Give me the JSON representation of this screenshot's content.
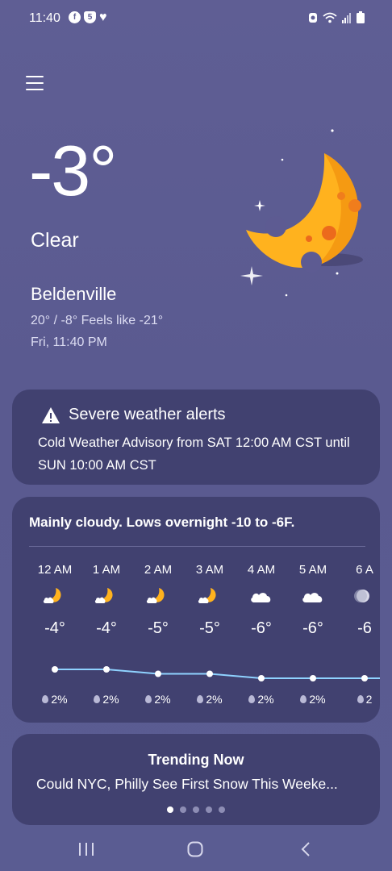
{
  "status_bar": {
    "time": "11:40",
    "left_icons": [
      "facebook-icon",
      "shield-icon",
      "heart-icon"
    ],
    "right_icons": [
      "alarm-icon",
      "wifi-icon",
      "signal-icon",
      "battery-icon"
    ]
  },
  "weather": {
    "temperature": "-3°",
    "condition": "Clear",
    "location": "Beldenville",
    "hi_lo_feels": "20° / -8° Feels like -21°",
    "datetime": "Fri, 11:40 PM",
    "icon": "moon-icon"
  },
  "alert": {
    "title": "Severe weather alerts",
    "message": "Cold Weather Advisory from SAT 12:00 AM CST until SUN 10:00 AM CST",
    "icon": "warning-icon"
  },
  "forecast": {
    "summary": "Mainly cloudy. Lows overnight -10 to -6F.",
    "hours": [
      {
        "time": "12 AM",
        "icon": "moon-partly-cloudy-icon",
        "temp": "-4°",
        "temp_value": -4,
        "precip": "2%"
      },
      {
        "time": "1 AM",
        "icon": "moon-partly-cloudy-icon",
        "temp": "-4°",
        "temp_value": -4,
        "precip": "2%"
      },
      {
        "time": "2 AM",
        "icon": "moon-partly-cloudy-icon",
        "temp": "-5°",
        "temp_value": -5,
        "precip": "2%"
      },
      {
        "time": "3 AM",
        "icon": "moon-partly-cloudy-icon",
        "temp": "-5°",
        "temp_value": -5,
        "precip": "2%"
      },
      {
        "time": "4 AM",
        "icon": "cloud-icon",
        "temp": "-6°",
        "temp_value": -6,
        "precip": "2%"
      },
      {
        "time": "5 AM",
        "icon": "cloud-icon",
        "temp": "-6°",
        "temp_value": -6,
        "precip": "2%"
      },
      {
        "time": "6 A",
        "icon": "moon-icon",
        "temp": "-6",
        "temp_value": -6,
        "precip": "2"
      }
    ]
  },
  "trending": {
    "title": "Trending Now",
    "headline": "Could NYC, Philly See First Snow This Weeke...",
    "page_count": 5,
    "active_page": 1
  },
  "nav": {
    "recent_icon": "recent-apps-icon",
    "home_icon": "home-icon",
    "back_icon": "back-icon"
  },
  "colors": {
    "background": "#5f5e94",
    "card": "#414170",
    "moon_yellow": "#ffb21e",
    "chart_line": "#8fd2ff"
  }
}
